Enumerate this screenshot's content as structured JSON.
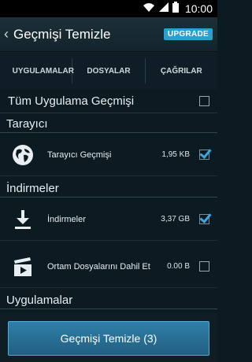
{
  "status_bar": {
    "time": "10:00",
    "icons": [
      "wifi-icon",
      "signal-icon",
      "battery-icon"
    ]
  },
  "action_bar": {
    "title": "Geçmişi Temizle",
    "upgrade_label": "UPGRADE"
  },
  "tabs": [
    {
      "label": "UYGULAMALAR"
    },
    {
      "label": "DOSYALAR"
    },
    {
      "label": "ÇAĞRILAR"
    }
  ],
  "all_history": {
    "label": "Tüm Uygulama Geçmişi",
    "checked": false
  },
  "sections": {
    "browser": {
      "title": "Tarayıcı",
      "item": {
        "name": "Tarayıcı Geçmişi",
        "size": "1,95 KB",
        "checked": true,
        "icon": "globe-icon"
      }
    },
    "downloads": {
      "title": "İndirmeler",
      "items": [
        {
          "name": "İndirmeler",
          "size": "3,37 GB",
          "checked": true,
          "icon": "download-icon"
        },
        {
          "name": "Ortam Dosyalarını Dahil Et",
          "size": "0.00 B",
          "checked": false,
          "icon": "media-clapper-icon"
        }
      ]
    },
    "apps": {
      "title": "Uygulamalar"
    }
  },
  "clear_button": {
    "label": "Geçmişi Temizle (3)"
  },
  "colors": {
    "accent": "#2a9fd0",
    "background": "#0c1a22",
    "button": "#2f7fa8"
  }
}
